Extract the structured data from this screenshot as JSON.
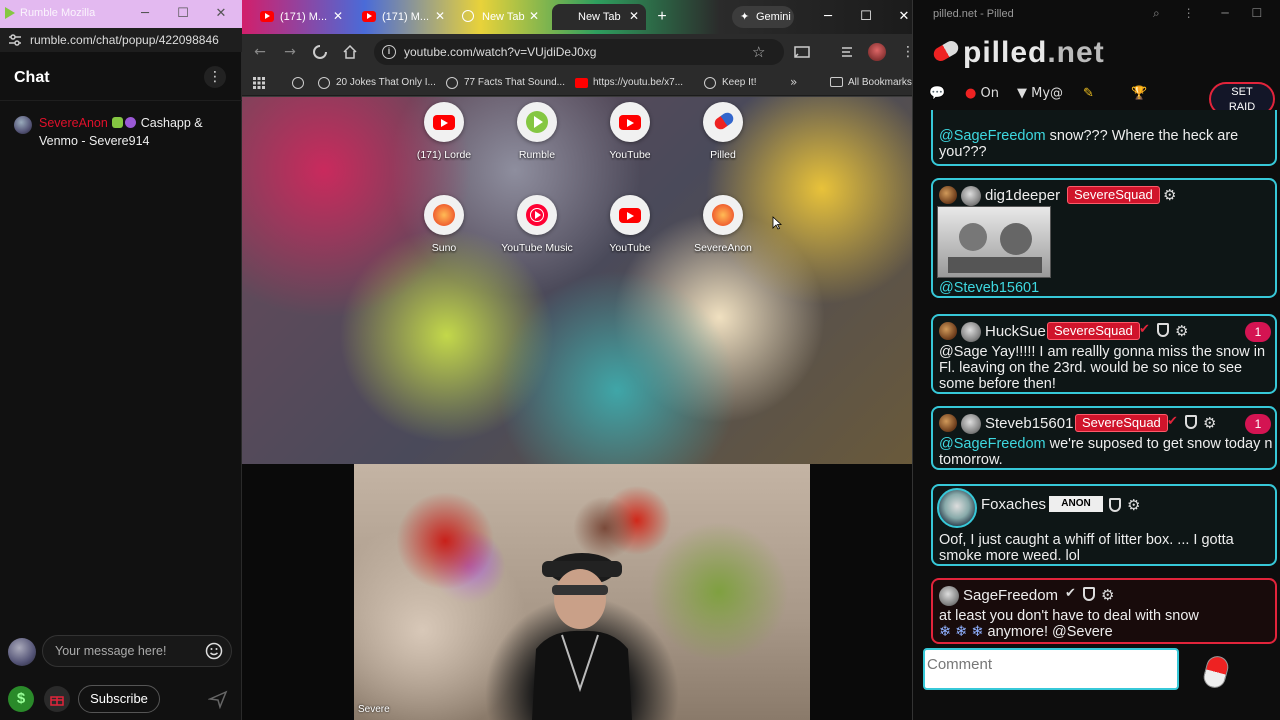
{
  "rumble": {
    "window_title": "Rumble Mozilla",
    "url": "rumble.com/chat/popup/422098846",
    "chat_title": "Chat",
    "message": {
      "username": "SevereAnon",
      "text": "Cashapp & Venmo - Severe914"
    },
    "input_placeholder": "Your message here!",
    "subscribe_label": "Subscribe",
    "dollar_label": "$"
  },
  "chrome": {
    "tabs": [
      {
        "label": "(171) M..."
      },
      {
        "label": "(171) M..."
      },
      {
        "label": "New Tab"
      },
      {
        "label": "New Tab"
      }
    ],
    "gemini_label": "Gemini",
    "url": "youtube.com/watch?v=VUjdiDeJ0xg",
    "bookmarks": [
      "20 Jokes That Only I...",
      "77 Facts That Sound...",
      "https://youtu.be/x7...",
      "Keep It!",
      "All Bookmarks"
    ],
    "shortcuts": [
      {
        "label": "(171) Lorde",
        "icon": "youtube-icon"
      },
      {
        "label": "Rumble",
        "icon": "rumble-icon"
      },
      {
        "label": "YouTube",
        "icon": "youtube-icon"
      },
      {
        "label": "Pilled",
        "icon": "pill-icon"
      },
      {
        "label": "Suno",
        "icon": "suno-icon"
      },
      {
        "label": "YouTube Music",
        "icon": "youtube-music-icon"
      },
      {
        "label": "YouTube",
        "icon": "youtube-icon"
      },
      {
        "label": "SevereAnon",
        "icon": "suno-icon"
      }
    ]
  },
  "webcam": {
    "label": "Severe"
  },
  "pilled": {
    "window_title": "pilled.net - Pilled",
    "brand": "pilled",
    "brand_tld": ".net",
    "toolbar": {
      "on_label": "On",
      "my_label": "My@",
      "raid_line1": "SET",
      "raid_line2": "RAID"
    },
    "messages": [
      {
        "mention": "@SageFreedom",
        "text": " snow??? Where the heck are you???"
      },
      {
        "username": "dig1deeper",
        "tag": "SevereSquad",
        "mention": "@Steveb15601",
        "text": ""
      },
      {
        "username": "HuckSue",
        "tag": "SevereSquad",
        "count": "1",
        "text": "@Sage Yay!!!!! I am reallly gonna miss the snow in Fl. leaving on the 23rd. would be so nice to see some before then!"
      },
      {
        "username": "Steveb15601",
        "tag": "SevereSquad",
        "count": "1",
        "mention": "@SageFreedom",
        "text": " we're suposed to get snow today n tomorrow."
      },
      {
        "username": "Foxaches",
        "tag_text": "ANON",
        "text": "Oof, I just caught a whiff of litter box. ... I gotta smoke more weed. lol"
      },
      {
        "username": "SageFreedom",
        "text1": "at least you don't have to deal with snow",
        "snow": "❄ ❄ ❄",
        "text2": " anymore! @Severe"
      }
    ],
    "comment_placeholder": "Comment"
  },
  "colors": {
    "accent_cyan": "#37c8d8",
    "accent_red": "#e2243b",
    "rumble_green": "#85c742",
    "youtube_red": "#ff0000"
  }
}
